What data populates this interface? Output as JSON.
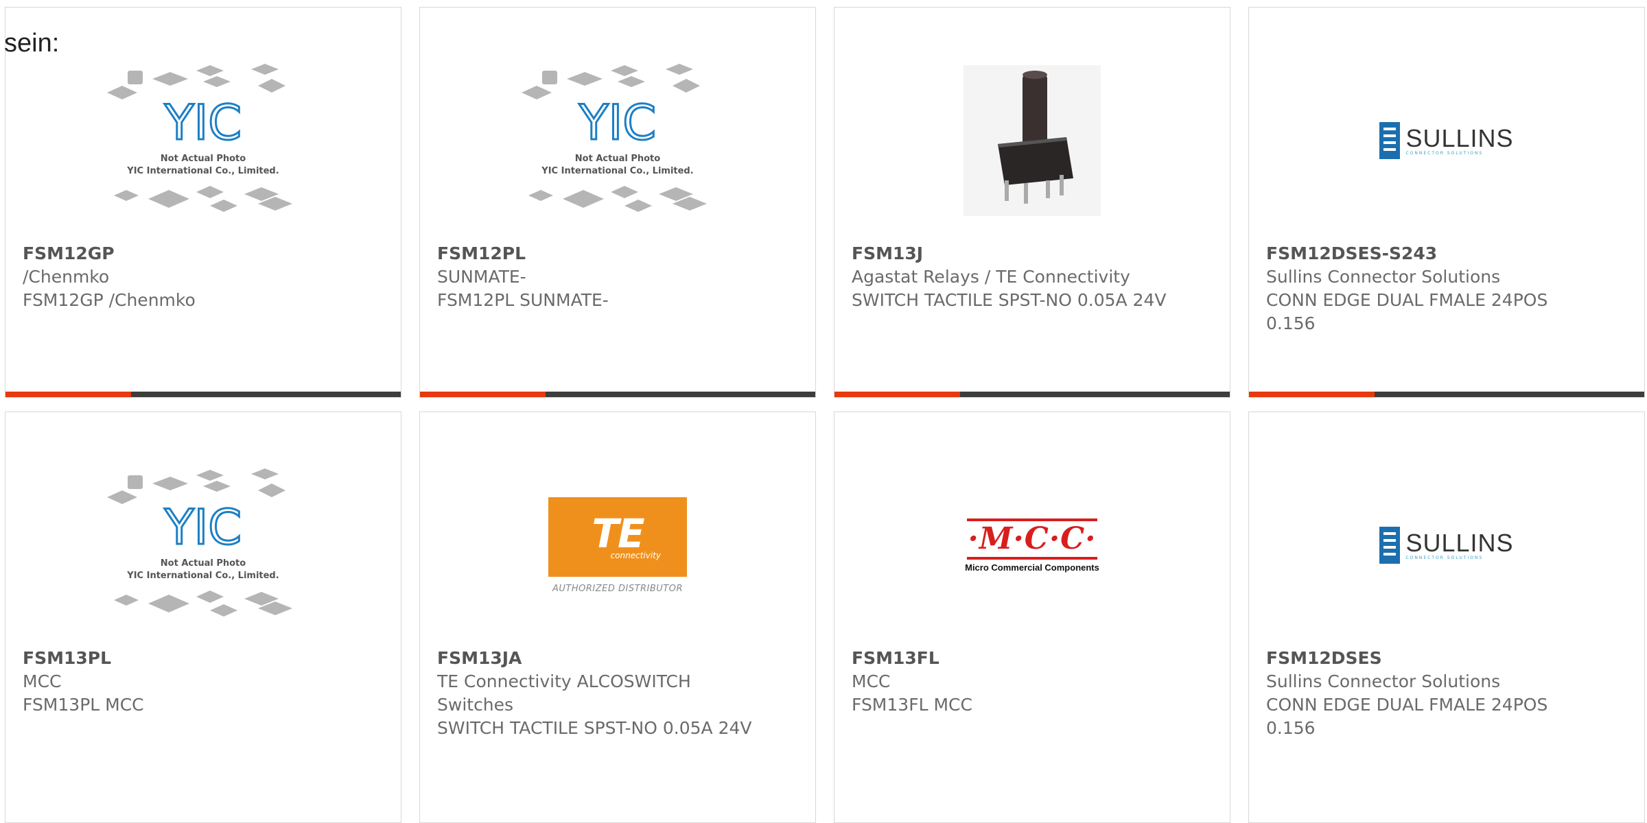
{
  "page": {
    "heading": "sein:"
  },
  "yic_placeholder": {
    "brand": "YIC",
    "line1": "Not Actual Photo",
    "line2": "YIC International Co., Limited."
  },
  "te_logo": {
    "main": "TE",
    "sub": "connectivity",
    "authorized": "AUTHORIZED DISTRIBUTOR"
  },
  "mcc_logo": {
    "main": "·M·C·C·",
    "sub": "Micro Commercial Components"
  },
  "sullins_logo": {
    "name": "SULLINS",
    "tagline": "CONNECTOR SOLUTIONS"
  },
  "products": [
    {
      "part": "FSM12GP",
      "maker": "/Chenmko",
      "desc": "FSM12GP /Chenmko",
      "image": "yic-placeholder"
    },
    {
      "part": "FSM12PL",
      "maker": "SUNMATE-",
      "desc": "FSM12PL SUNMATE-",
      "image": "yic-placeholder"
    },
    {
      "part": "FSM13J",
      "maker": "Agastat Relays / TE Connectivity",
      "desc": "SWITCH TACTILE SPST-NO 0.05A 24V",
      "image": "tactile-switch-photo"
    },
    {
      "part": "FSM12DSES-S243",
      "maker": "Sullins Connector Solutions",
      "desc": "CONN EDGE DUAL FMALE 24POS 0.156",
      "image": "sullins-logo"
    },
    {
      "part": "FSM13PL",
      "maker": "MCC",
      "desc": "FSM13PL MCC",
      "image": "yic-placeholder"
    },
    {
      "part": "FSM13JA",
      "maker": "TE Connectivity ALCOSWITCH Switches",
      "desc": "SWITCH TACTILE SPST-NO 0.05A 24V",
      "image": "te-logo"
    },
    {
      "part": "FSM13FL",
      "maker": "MCC",
      "desc": "FSM13FL MCC",
      "image": "mcc-logo"
    },
    {
      "part": "FSM12DSES",
      "maker": "Sullins Connector Solutions",
      "desc": "CONN EDGE DUAL FMALE 24POS 0.156",
      "image": "sullins-logo"
    }
  ],
  "colors": {
    "accent": "#e8380d",
    "bar": "#3d3d3d",
    "te_orange": "#f0901c",
    "mcc_red": "#d81e1e",
    "sullins_blue": "#1c6fae",
    "yic_blue": "#1c7fc4"
  }
}
